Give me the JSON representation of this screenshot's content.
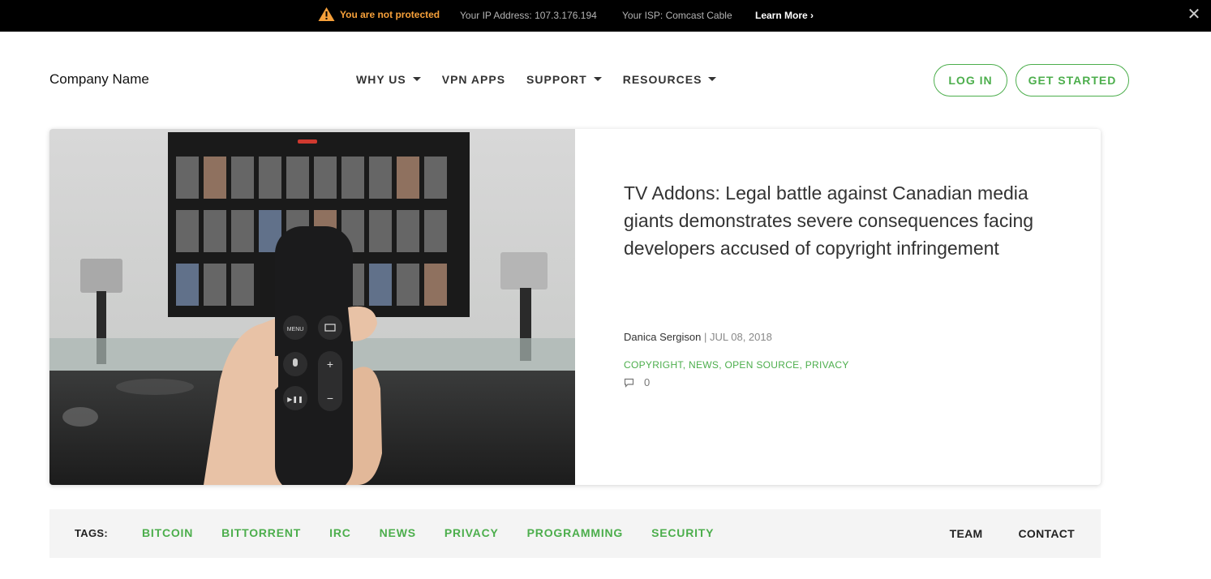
{
  "alert": {
    "warning": "You are not protected",
    "ip": "Your IP Address: 107.3.176.194",
    "isp": "Your ISP: Comcast Cable",
    "learn_more": "Learn More ›",
    "close": "✕",
    "warning_color": "#f6a03a"
  },
  "header": {
    "brand": "Company Name",
    "nav": [
      {
        "label": "WHY US",
        "dropdown": true
      },
      {
        "label": "VPN APPS",
        "dropdown": false
      },
      {
        "label": "SUPPORT",
        "dropdown": true
      },
      {
        "label": "RESOURCES",
        "dropdown": true
      }
    ],
    "login": "LOG IN",
    "get_started": "GET STARTED",
    "accent": "#4cae4c"
  },
  "article": {
    "title": "TV Addons: Legal battle against Canadian media giants demonstrates severe consequences facing developers accused of copyright infringement",
    "author": "Danica Sergison",
    "separator": " | ",
    "date": "JUL 08, 2018",
    "categories": [
      "COPYRIGHT",
      "NEWS",
      "OPEN SOURCE",
      "PRIVACY"
    ],
    "comment_count": "0",
    "image_icon": "tv-remote-photo"
  },
  "tagbar": {
    "label": "TAGS:",
    "tags": [
      "BITCOIN",
      "BITTORRENT",
      "IRC",
      "NEWS",
      "PRIVACY",
      "PROGRAMMING",
      "SECURITY"
    ],
    "links": [
      "TEAM",
      "CONTACT"
    ]
  }
}
